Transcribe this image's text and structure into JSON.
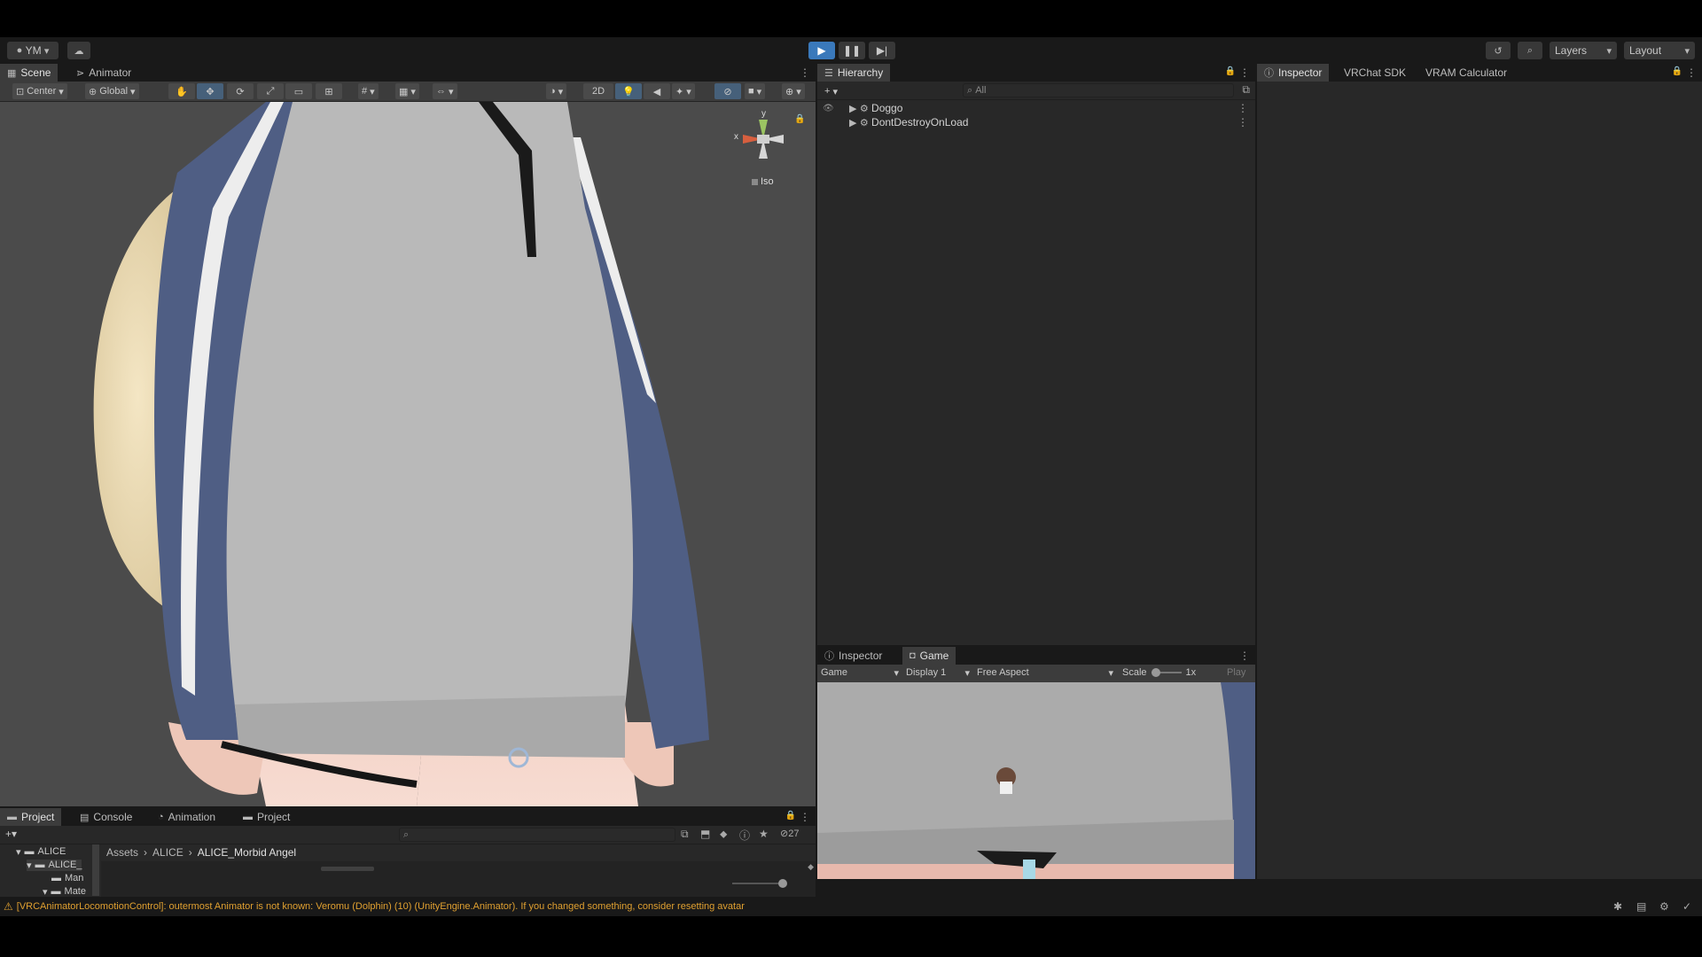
{
  "toolbar": {
    "account": "YM",
    "layers": "Layers",
    "layout": "Layout"
  },
  "scene": {
    "tabs": [
      "Scene",
      "Animator"
    ],
    "pivot": "Center",
    "space": "Global",
    "mode_2d": "2D",
    "gizmo_y": "y",
    "gizmo_x": "x",
    "iso": "Iso"
  },
  "hierarchy": {
    "tab": "Hierarchy",
    "search_placeholder": "All",
    "items": [
      "Doggo",
      "DontDestroyOnLoad"
    ]
  },
  "inspector_panel": {
    "tabs": [
      "Inspector",
      "VRChat SDK",
      "VRAM Calculator"
    ]
  },
  "game": {
    "tabs": [
      "Inspector",
      "Game"
    ],
    "mode": "Game",
    "display": "Display 1",
    "aspect": "Free Aspect",
    "scale_label": "Scale",
    "scale_value": "1x",
    "play_label": "Play"
  },
  "project": {
    "tabs": [
      "Project",
      "Console",
      "Animation",
      "Project"
    ],
    "hidden_count": "27",
    "tree": [
      "ALICE",
      "ALICE_",
      "Man",
      "Mate"
    ],
    "breadcrumb": [
      "Assets",
      "ALICE",
      "ALICE_Morbid Angel"
    ]
  },
  "status_message": "[VRCAnimatorLocomotionControl]: outermost Animator is not known: Veromu (Dolphin) (10) (UnityEngine.Animator). If you changed something, consider resetting avatar",
  "colors": {
    "accent": "#3a79bb",
    "warning": "#e0a030",
    "panel": "#282828",
    "toolbar": "#191919"
  }
}
